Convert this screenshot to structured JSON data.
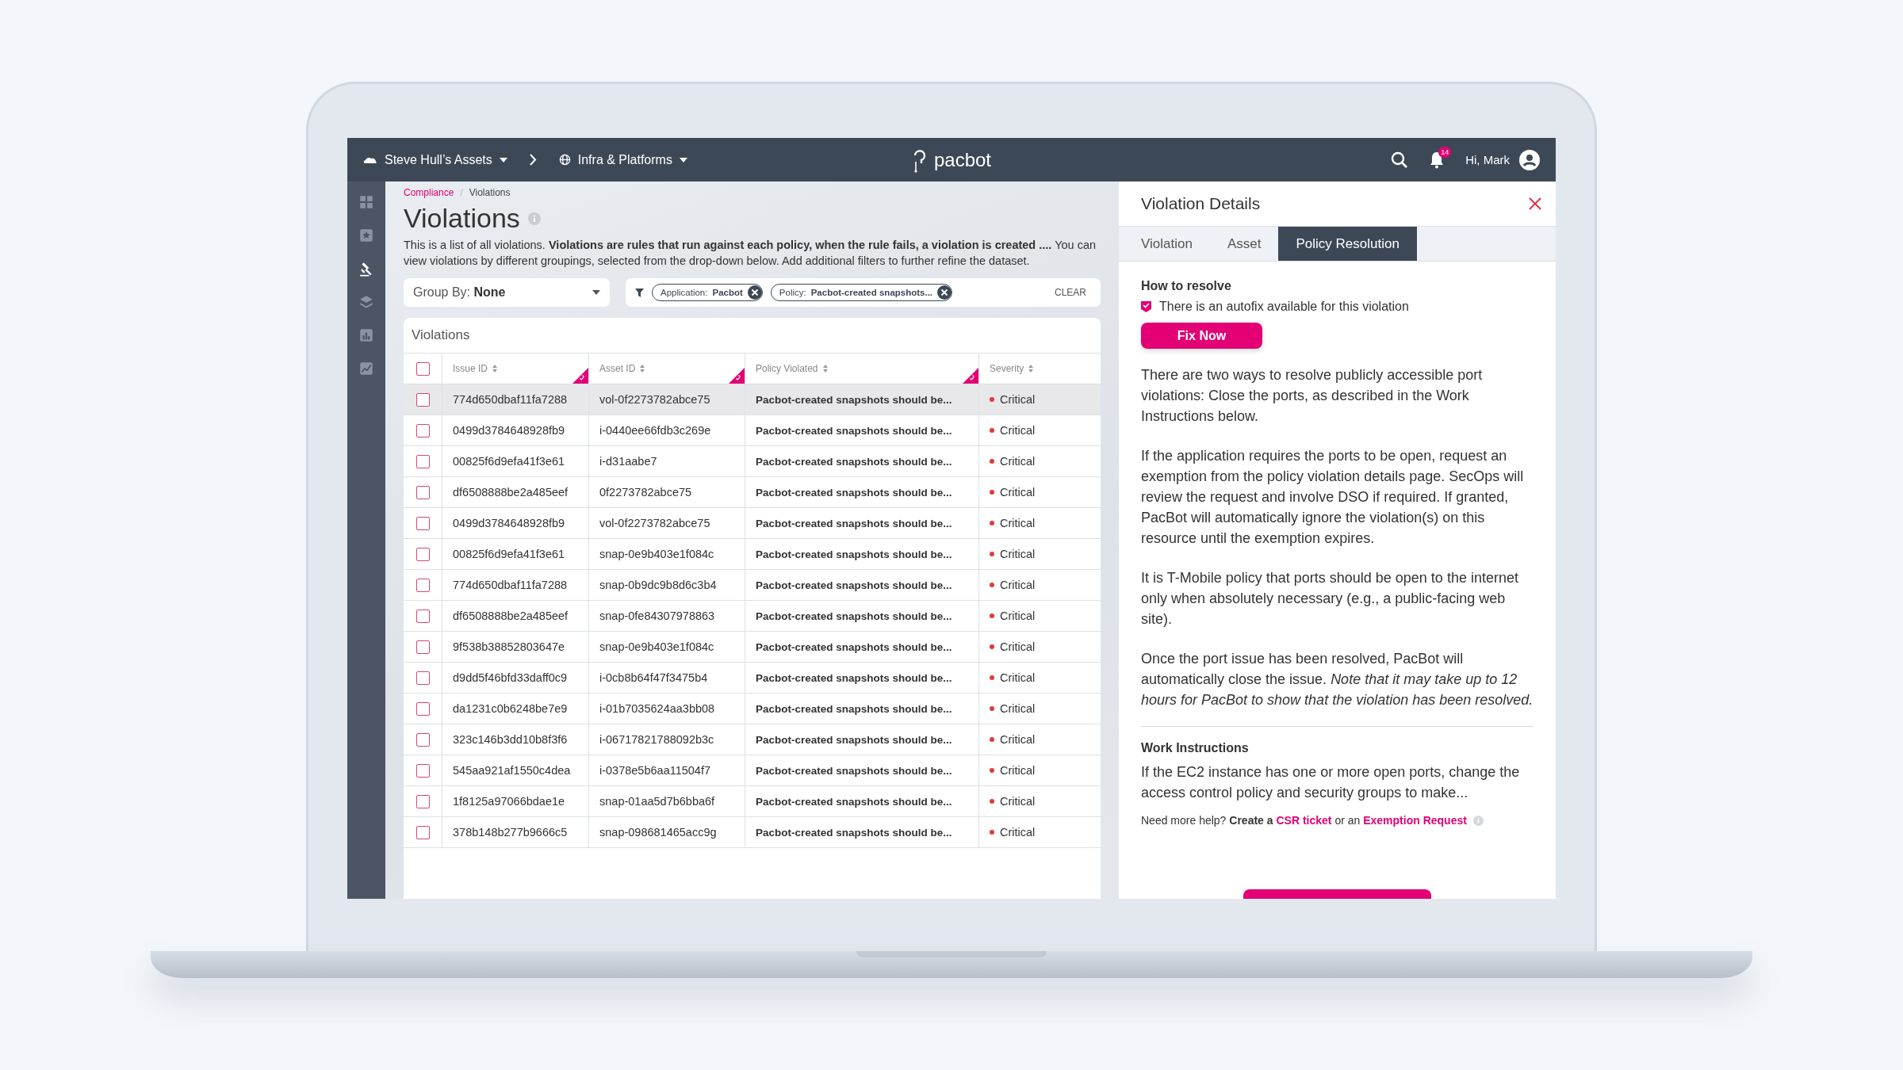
{
  "topbar": {
    "asset_group": "Steve Hull’s Assets",
    "domain": "Infra & Platforms",
    "logo": "pacbot",
    "notifications": "14",
    "greeting": "Hi, Mark"
  },
  "sidebar": {
    "items": [
      {
        "kind": "grid",
        "selected": false
      },
      {
        "kind": "star",
        "selected": false
      },
      {
        "kind": "gavel",
        "selected": true
      },
      {
        "kind": "layers",
        "selected": false
      },
      {
        "kind": "chart",
        "selected": false
      },
      {
        "kind": "trend",
        "selected": false
      }
    ]
  },
  "breadcrumb": {
    "separator": "/",
    "items": [
      {
        "label": "Compliance",
        "kind": "link"
      },
      {
        "label": "Violations",
        "kind": "current"
      }
    ]
  },
  "page": {
    "title": "Violations",
    "description": "This is a list of all violations. **Violations are rules that run against each policy, when the rule fails, a violation is created ....** You can view violations by different groupings, selected from the drop-down below. Add additional filters to further refine the dataset."
  },
  "group_by": {
    "label": "Group By:",
    "value": "None"
  },
  "filters": {
    "chips": [
      {
        "label": "Application:",
        "value": "Pacbot"
      },
      {
        "label": "Policy:",
        "value": "Pacbot-created snapshots..."
      }
    ],
    "clear": "CLEAR"
  },
  "table": {
    "title": "Violations",
    "all_checked": false,
    "columns": [
      {
        "label": "Issue ID",
        "linked": true
      },
      {
        "label": "Asset ID",
        "linked": true
      },
      {
        "label": "Policy Violated",
        "linked": true
      },
      {
        "label": "Severity",
        "linked": false
      }
    ],
    "rows": [
      {
        "selected": true,
        "checked": false,
        "issue_id": "774d650dbaf11fa7288",
        "asset_id": "vol-0f2273782abce75",
        "policy": "Pacbot-created snapshots should be...",
        "severity": "Critical"
      },
      {
        "selected": false,
        "checked": false,
        "issue_id": "0499d3784648928fb9",
        "asset_id": "i-0440ee66fdb3c269e",
        "policy": "Pacbot-created snapshots should be...",
        "severity": "Critical"
      },
      {
        "selected": false,
        "checked": false,
        "issue_id": "00825f6d9efa41f3e61",
        "asset_id": "i-d31aabe7",
        "policy": "Pacbot-created snapshots should be...",
        "severity": "Critical"
      },
      {
        "selected": false,
        "checked": false,
        "issue_id": "df6508888be2a485eef",
        "asset_id": "0f2273782abce75",
        "policy": "Pacbot-created snapshots should be...",
        "severity": "Critical"
      },
      {
        "selected": false,
        "checked": false,
        "issue_id": "0499d3784648928fb9",
        "asset_id": "vol-0f2273782abce75",
        "policy": "Pacbot-created snapshots should be...",
        "severity": "Critical"
      },
      {
        "selected": false,
        "checked": false,
        "issue_id": "00825f6d9efa41f3e61",
        "asset_id": "snap-0e9b403e1f084c",
        "policy": "Pacbot-created snapshots should be...",
        "severity": "Critical"
      },
      {
        "selected": false,
        "checked": false,
        "issue_id": "774d650dbaf11fa7288",
        "asset_id": "snap-0b9dc9b8d6c3b4",
        "policy": "Pacbot-created snapshots should be...",
        "severity": "Critical"
      },
      {
        "selected": false,
        "checked": false,
        "issue_id": "df6508888be2a485eef",
        "asset_id": "snap-0fe84307978863",
        "policy": "Pacbot-created snapshots should be...",
        "severity": "Critical"
      },
      {
        "selected": false,
        "checked": false,
        "issue_id": "9f538b38852803647e",
        "asset_id": "snap-0e9b403e1f084c",
        "policy": "Pacbot-created snapshots should be...",
        "severity": "Critical"
      },
      {
        "selected": false,
        "checked": false,
        "issue_id": "d9dd5f46bfd33daff0c9",
        "asset_id": "i-0cb8b64f47f3475b4",
        "policy": "Pacbot-created snapshots should be...",
        "severity": "Critical"
      },
      {
        "selected": false,
        "checked": false,
        "issue_id": "da1231c0b6248be7e9",
        "asset_id": "i-01b7035624aa3bb08",
        "policy": "Pacbot-created snapshots should be...",
        "severity": "Critical"
      },
      {
        "selected": false,
        "checked": false,
        "issue_id": "323c146b3dd10b8f3f6",
        "asset_id": "i-06717821788092b3c",
        "policy": "Pacbot-created snapshots should be...",
        "severity": "Critical"
      },
      {
        "selected": false,
        "checked": false,
        "issue_id": "545aa921af1550c4dea",
        "asset_id": "i-0378e5b6aa11504f7",
        "policy": "Pacbot-created snapshots should be...",
        "severity": "Critical"
      },
      {
        "selected": false,
        "checked": false,
        "issue_id": "1f8125a97066bdae1e",
        "asset_id": "snap-01aa5d7b6bba6f",
        "policy": "Pacbot-created snapshots should be...",
        "severity": "Critical"
      },
      {
        "selected": false,
        "checked": false,
        "issue_id": "378b148b277b9666c5",
        "asset_id": "snap-098681465acc9g",
        "policy": "Pacbot-created snapshots should be...",
        "severity": "Critical"
      }
    ]
  },
  "details": {
    "title": "Violation Details",
    "tabs": [
      {
        "label": "Violation",
        "selected": false
      },
      {
        "label": "Asset",
        "selected": false
      },
      {
        "label": "Policy Resolution",
        "selected": true
      }
    ],
    "how_to_resolve": {
      "heading": "How to resolve",
      "autofix": {
        "label": "There is an autofix available for this violation",
        "checked": true
      },
      "button": "Fix Now"
    },
    "paragraphs": [
      "There are two ways to resolve publicly accessible port violations: Close the ports, as described in the Work Instructions below.",
      "If the application requires the ports to be open, request an exemption from the policy violation details page. SecOps will review the request and involve DSO if required. If granted, PacBot will automatically ignore the violation(s) on this resource until the exemption expires.",
      "It is T-Mobile policy that ports should be open to the internet only when absolutely necessary (e.g., a public-facing web site).",
      "Once the port issue has been resolved, PacBot will automatically close the issue. *Note that it may take up to 12 hours for PacBot to show that the violation has been resolved.*"
    ],
    "work_instructions": {
      "heading": "Work Instructions",
      "text": "If the EC2 instance has one or more open ports, change the access control policy and security groups to make..."
    },
    "help": [
      {
        "kind": "text",
        "text": "Need more help?"
      },
      {
        "kind": "bold",
        "text": "Create a"
      },
      {
        "kind": "link",
        "text": "CSR ticket"
      },
      {
        "kind": "text",
        "text": "or an"
      },
      {
        "kind": "link",
        "text": "Exemption Request"
      }
    ]
  }
}
